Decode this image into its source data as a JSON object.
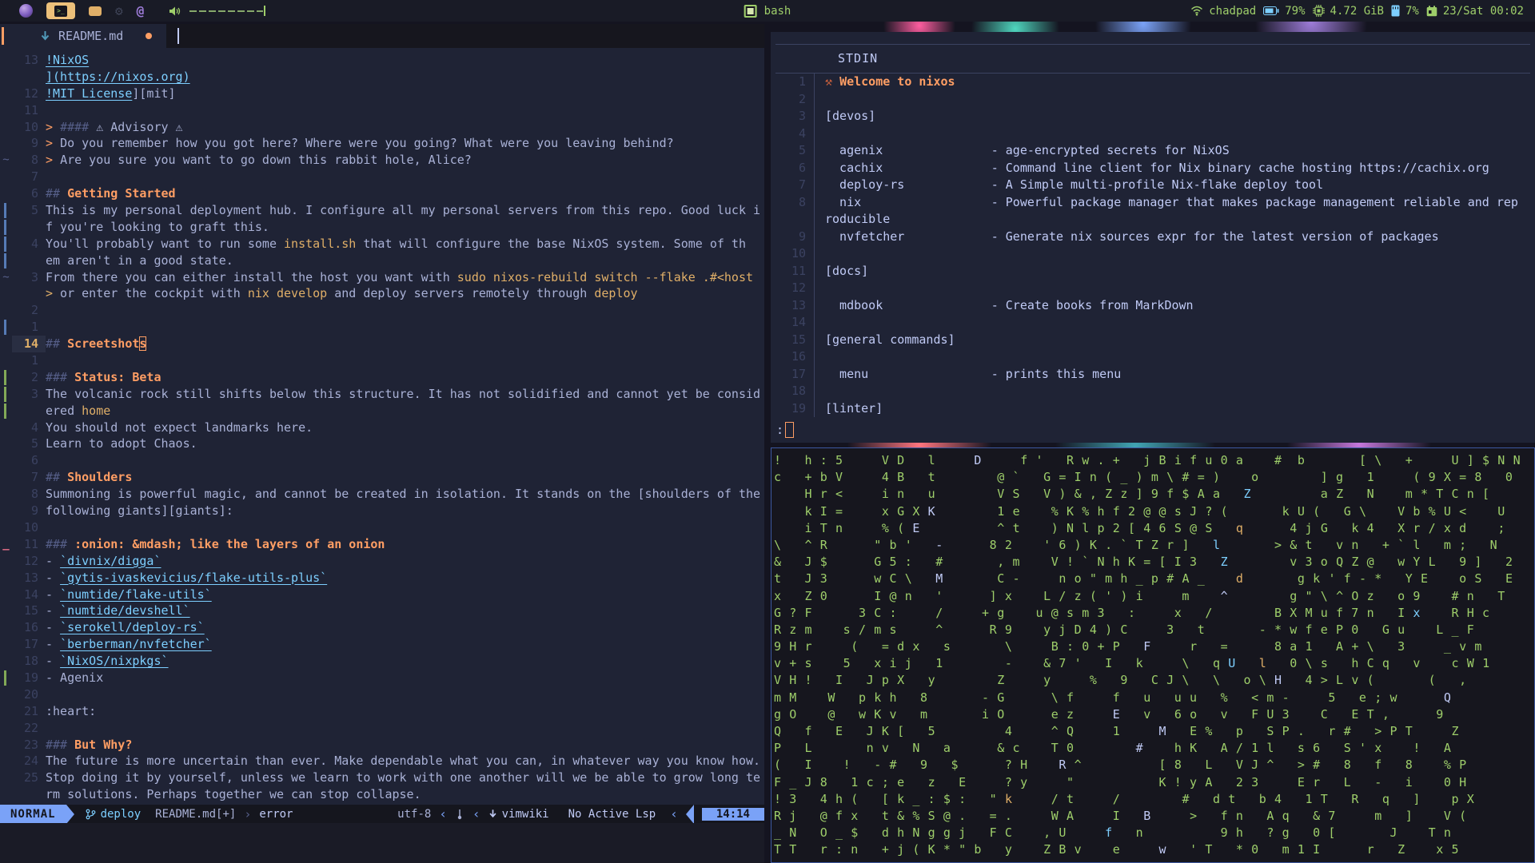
{
  "palette": {
    "bg": "#1f2335",
    "bar_bg": "#191b26",
    "accent_blue": "#7aa2f7",
    "accent_cyan": "#7dcfff",
    "accent_orange": "#ff9e64",
    "accent_yellow": "#e0af68",
    "accent_green": "#9ece6a",
    "accent_red": "#f7768e",
    "fg": "#a9b1d6",
    "dim": "#565f89",
    "linenr": "#3b4261"
  },
  "topbar": {
    "center_label": "bash",
    "network": "chadpad",
    "battery": "79%",
    "memory": "4.72 GiB",
    "cpu": "7%",
    "clock": "23/Sat 00:02"
  },
  "editor": {
    "tab": {
      "name": "README.md"
    },
    "statusline": {
      "mode": "NORMAL",
      "branch": "deploy",
      "file": "README.md[+]",
      "sep_r": "›",
      "diagnostic": "error",
      "encoding": "utf-8",
      "sep_l1": "‹",
      "sep_l2": "‹",
      "filetype": "vimwiki",
      "lsp": "No Active Lsp",
      "sep_l3": "‹",
      "position": "14:14"
    },
    "lines": [
      {
        "n": "13",
        "s": "",
        "segs": [
          {
            "c": "link",
            "t": "!NixOS"
          }
        ]
      },
      {
        "n": "",
        "s": "",
        "segs": [
          {
            "c": "link",
            "t": "](https://nixos.org)"
          }
        ]
      },
      {
        "n": "12",
        "s": "",
        "segs": [
          {
            "c": "link",
            "t": "!MIT License"
          },
          {
            "c": "txt",
            "t": "][mit]"
          }
        ]
      },
      {
        "n": "11",
        "s": "",
        "segs": []
      },
      {
        "n": "10",
        "s": "",
        "segs": [
          {
            "c": "quote",
            "t": "> "
          },
          {
            "c": "punct",
            "t": "#### "
          },
          {
            "c": "txt",
            "t": "⚠ Advisory ⚠"
          }
        ]
      },
      {
        "n": "9",
        "s": "",
        "segs": [
          {
            "c": "quote",
            "t": "> "
          },
          {
            "c": "txt",
            "t": "Do you remember how you got here? Where were you going? What were you leaving behind?"
          }
        ]
      },
      {
        "n": "8",
        "s": "tilde",
        "segs": [
          {
            "c": "quote",
            "t": "> "
          },
          {
            "c": "txt",
            "t": "Are you sure you want to go down this rabbit hole, Alice?"
          }
        ]
      },
      {
        "n": "7",
        "s": "",
        "segs": []
      },
      {
        "n": "6",
        "s": "",
        "segs": [
          {
            "c": "punct",
            "t": "## "
          },
          {
            "c": "h",
            "t": "Getting Started"
          }
        ]
      },
      {
        "n": "5",
        "s": "blue",
        "segs": [
          {
            "c": "txt",
            "t": "This is my personal deployment hub. I configure all my personal servers from this repo. Good luck i"
          }
        ]
      },
      {
        "n": "",
        "s": "blue",
        "segs": [
          {
            "c": "txt",
            "t": "f you're looking to graft this."
          }
        ]
      },
      {
        "n": "4",
        "s": "blue",
        "segs": [
          {
            "c": "txt",
            "t": "You'll probably want to run some "
          },
          {
            "c": "code",
            "t": "install.sh"
          },
          {
            "c": "txt",
            "t": " that will configure the base NixOS system. Some of th"
          }
        ]
      },
      {
        "n": "",
        "s": "blue",
        "segs": [
          {
            "c": "txt",
            "t": "em aren't in a good state."
          }
        ]
      },
      {
        "n": "3",
        "s": "tilde",
        "segs": [
          {
            "c": "txt",
            "t": "From there you can either install the host you want with "
          },
          {
            "c": "code",
            "t": "sudo nixos-rebuild switch --flake .#<host"
          }
        ]
      },
      {
        "n": "",
        "s": "",
        "segs": [
          {
            "c": "code",
            "t": ">"
          },
          {
            "c": "txt",
            "t": " or enter the cockpit with "
          },
          {
            "c": "code",
            "t": "nix develop"
          },
          {
            "c": "txt",
            "t": " and deploy servers remotely through "
          },
          {
            "c": "code",
            "t": "deploy"
          }
        ]
      },
      {
        "n": "2",
        "s": "",
        "segs": []
      },
      {
        "n": "1",
        "s": "blue",
        "segs": []
      },
      {
        "n": "14",
        "s": "",
        "cur": true,
        "segs": [
          {
            "c": "punct",
            "t": "## "
          },
          {
            "c": "h",
            "t": "Screetshot"
          },
          {
            "c": "hcur",
            "t": "s"
          }
        ]
      },
      {
        "n": "1",
        "s": "",
        "segs": []
      },
      {
        "n": "2",
        "s": "green",
        "segs": [
          {
            "c": "punct",
            "t": "### "
          },
          {
            "c": "h",
            "t": "Status: Beta"
          }
        ]
      },
      {
        "n": "3",
        "s": "green",
        "segs": [
          {
            "c": "txt",
            "t": "The volcanic rock still shifts below this structure. It has not solidified and cannot yet be consid"
          }
        ]
      },
      {
        "n": "",
        "s": "green",
        "segs": [
          {
            "c": "txt",
            "t": "ered "
          },
          {
            "c": "code",
            "t": "home"
          }
        ]
      },
      {
        "n": "4",
        "s": "",
        "segs": [
          {
            "c": "txt",
            "t": "You should not expect landmarks here."
          }
        ]
      },
      {
        "n": "5",
        "s": "",
        "segs": [
          {
            "c": "txt",
            "t": "Learn to adopt Chaos."
          }
        ]
      },
      {
        "n": "6",
        "s": "",
        "segs": []
      },
      {
        "n": "7",
        "s": "",
        "segs": [
          {
            "c": "punct",
            "t": "## "
          },
          {
            "c": "h",
            "t": "Shoulders"
          }
        ]
      },
      {
        "n": "8",
        "s": "",
        "segs": [
          {
            "c": "txt",
            "t": "Summoning is powerful magic, and cannot be created in isolation. It stands on the [shoulders of the"
          }
        ]
      },
      {
        "n": "9",
        "s": "",
        "segs": [
          {
            "c": "txt",
            "t": "following giants][giants]:"
          }
        ]
      },
      {
        "n": "10",
        "s": "",
        "segs": []
      },
      {
        "n": "11",
        "s": "del",
        "segs": [
          {
            "c": "punct",
            "t": "### "
          },
          {
            "c": "h",
            "t": ":onion: &mdash; like the layers of an onion"
          }
        ]
      },
      {
        "n": "12",
        "s": "",
        "segs": [
          {
            "c": "txt",
            "t": "- "
          },
          {
            "c": "link",
            "t": "`divnix/digga`"
          }
        ]
      },
      {
        "n": "13",
        "s": "",
        "segs": [
          {
            "c": "txt",
            "t": "- "
          },
          {
            "c": "link",
            "t": "`gytis-ivaskevicius/flake-utils-plus`"
          }
        ]
      },
      {
        "n": "14",
        "s": "",
        "segs": [
          {
            "c": "txt",
            "t": "- "
          },
          {
            "c": "link",
            "t": "`numtide/flake-utils`"
          }
        ]
      },
      {
        "n": "15",
        "s": "",
        "segs": [
          {
            "c": "txt",
            "t": "- "
          },
          {
            "c": "link",
            "t": "`numtide/devshell`"
          }
        ]
      },
      {
        "n": "16",
        "s": "",
        "segs": [
          {
            "c": "txt",
            "t": "- "
          },
          {
            "c": "link",
            "t": "`serokell/deploy-rs`"
          }
        ]
      },
      {
        "n": "17",
        "s": "",
        "segs": [
          {
            "c": "txt",
            "t": "- "
          },
          {
            "c": "link",
            "t": "`berberman/nvfetcher`"
          }
        ]
      },
      {
        "n": "18",
        "s": "",
        "segs": [
          {
            "c": "txt",
            "t": "- "
          },
          {
            "c": "link",
            "t": "`NixOS/nixpkgs`"
          }
        ]
      },
      {
        "n": "19",
        "s": "green",
        "segs": [
          {
            "c": "txt",
            "t": "- Agenix"
          }
        ]
      },
      {
        "n": "20",
        "s": "",
        "segs": []
      },
      {
        "n": "21",
        "s": "",
        "segs": [
          {
            "c": "txt",
            "t": ":heart:"
          }
        ]
      },
      {
        "n": "22",
        "s": "",
        "segs": []
      },
      {
        "n": "23",
        "s": "",
        "segs": [
          {
            "c": "punct",
            "t": "### "
          },
          {
            "c": "h",
            "t": "But Why?"
          }
        ]
      },
      {
        "n": "24",
        "s": "",
        "segs": [
          {
            "c": "txt",
            "t": "The future is more uncertain than ever. Make dependable what you can, in whatever way you know how."
          }
        ]
      },
      {
        "n": "25",
        "s": "",
        "segs": [
          {
            "c": "txt",
            "t": "Stop doing it by yourself, unless we learn to work with one another will we be able to grow long te"
          }
        ]
      },
      {
        "n": "",
        "s": "",
        "segs": [
          {
            "c": "txt",
            "t": "rm solutions. Perhaps together we can stop collapse."
          }
        ]
      }
    ]
  },
  "pager": {
    "header": "STDIN",
    "prompt": ":",
    "lines": [
      {
        "n": "1",
        "segs": [
          {
            "c": "hammer",
            "t": "⚒ "
          },
          {
            "c": "h",
            "t": "Welcome to nixos"
          }
        ]
      },
      {
        "n": "2",
        "segs": []
      },
      {
        "n": "3",
        "segs": [
          {
            "c": "white",
            "t": "[devos]"
          }
        ]
      },
      {
        "n": "4",
        "segs": []
      },
      {
        "n": "5",
        "segs": [
          {
            "c": "white",
            "t": "  agenix               - age-encrypted secrets for NixOS"
          }
        ]
      },
      {
        "n": "6",
        "segs": [
          {
            "c": "white",
            "t": "  cachix               - Command line client for Nix binary cache hosting https://cachix.org"
          }
        ]
      },
      {
        "n": "7",
        "segs": [
          {
            "c": "white",
            "t": "  deploy-rs            - A Simple multi-profile Nix-flake deploy tool"
          }
        ]
      },
      {
        "n": "8",
        "segs": [
          {
            "c": "white",
            "t": "  nix                  - Powerful package manager that makes package management reliable and rep"
          }
        ]
      },
      {
        "n": "",
        "segs": [
          {
            "c": "white",
            "t": "roducible"
          }
        ]
      },
      {
        "n": "9",
        "segs": [
          {
            "c": "white",
            "t": "  nvfetcher            - Generate nix sources expr for the latest version of packages"
          }
        ]
      },
      {
        "n": "10",
        "segs": []
      },
      {
        "n": "11",
        "segs": [
          {
            "c": "white",
            "t": "[docs]"
          }
        ]
      },
      {
        "n": "12",
        "segs": []
      },
      {
        "n": "13",
        "segs": [
          {
            "c": "white",
            "t": "  mdbook               - Create books from MarkDown"
          }
        ]
      },
      {
        "n": "14",
        "segs": []
      },
      {
        "n": "15",
        "segs": [
          {
            "c": "white",
            "t": "[general commands]"
          }
        ]
      },
      {
        "n": "16",
        "segs": []
      },
      {
        "n": "17",
        "segs": [
          {
            "c": "white",
            "t": "  menu                 - prints this menu"
          }
        ]
      },
      {
        "n": "18",
        "segs": []
      },
      {
        "n": "19",
        "segs": [
          {
            "c": "white",
            "t": "[linter]"
          }
        ]
      }
    ]
  },
  "noise": {
    "rows": [
      "!   h : 5     V D   l     D     f '   R w . +   j B i f u 0 a    #  b       [ \\   +     U ] $ N N",
      "c   + b V     4 B   t        @ `   G = I n ( _ ) m \\ # = )    o        ] g   1     ( 9 X = 8   0",
      "    H r <     i n   u        V S   V ) & , Z z ] 9 f $ A a   Z         a Z   N    m * T C n [",
      "    k I =     x G X K        1 e    % K % h f 2 @ @ s J ? (       k U (   G \\    V b % U <    U",
      "    i T n     % ( E          ^ t    ) N l p 2 [ 4 6 S @ S   q      4 j G   k 4   X r / x d    ;",
      "\\   ^ R      \" b '   -      8 2    ' 6 ) K . ` T Z r ]   l       > & t   v n   + ` l   m ;   N",
      "&   J $      G 5 :   #       , m    V ! ` N h K = [ I 3   Z        v 3 o Q Z @   w Y L   9 ]   2",
      "t   J 3      w C \\   M       C -     n o \" m h _ p # A _    d       g k ' f - *   Y E    o S   E",
      "x   Z 0      I @ n   '      ] x    L / z ( ' ) i     m    ^        g \" \\ ^ O z   o 9    # n   T",
      "G ? F      3 C :     /     + g    u @ s m 3   :     x   /        B X M u f 7 n   I x    R H c",
      "R z m    s / m s     ^      R 9    y j D 4 ) C     3   t       - * w f e P 0   G u    L _ F",
      "9 H r     (   = d x   s       \\     B : 0 + P   F     r   =      8 a 1   A + \\   3     _ v m",
      "v + s    5   x i j   1        -    & 7 '   I   k     \\   q U   l   0 \\ s   h C q   v    c W 1",
      "V H !   I   J p X   y        Z     y     %   9   C J \\   \\   o \\ H   4 > L v (       (   ,",
      "m M    W   p k h   8       - G      \\ f     f   u   u u   %   < m -     5   e ; w      Q",
      "g O    @   w K v   m       i O      e z     E   v   6 o   v   F U 3    C   E T ,      9",
      "Q   f   E   J K [   5         4     ^ Q     1     M   E %   p   S P .   r #   > P T     Z",
      "P   L       n v   N   a      & c    T 0        #    h K   A / 1 l   s 6   S ' x    !   A",
      "(   I    !   - #   9   $      ? H    R ^          [ 8   L   V J ^   > #   8   f   8    % P",
      "F _ J 8   1 c ; e   z   E     ? y     \"           K ! y A   2 3     E r   L   -   i    0 H",
      "! 3   4 h (   [ k _ : $ :   \" k     / t     /        #   d t   b 4   1 T   R   q   ]    p X",
      "R j   @ f x   t & % S @ .   = .     W A     I   B     >   f n   A q   & 7     m   ]    V (",
      "_ N   O _ $   d h N g g j   F C    , U     f   n          9 h   ? g   0 [       J    T n",
      "T T   r : n   + j ( K * \" b   y    Z B v    e     w   ' T   * 0   m 1 I      r   Z    x 5"
    ],
    "highlights": [
      [
        0,
        26,
        "w"
      ],
      [
        2,
        61,
        "c"
      ],
      [
        3,
        20,
        "w"
      ],
      [
        4,
        18,
        "w"
      ],
      [
        4,
        60,
        "y"
      ],
      [
        5,
        21,
        "w"
      ],
      [
        5,
        57,
        "c"
      ],
      [
        6,
        58,
        "c"
      ],
      [
        7,
        21,
        "w"
      ],
      [
        7,
        60,
        "y"
      ],
      [
        8,
        58,
        "w"
      ],
      [
        9,
        83,
        "c"
      ],
      [
        11,
        48,
        "w"
      ],
      [
        12,
        59,
        "c"
      ],
      [
        12,
        63,
        "y"
      ],
      [
        13,
        65,
        "w"
      ],
      [
        14,
        87,
        "w"
      ],
      [
        15,
        44,
        "w"
      ],
      [
        16,
        50,
        "w"
      ],
      [
        17,
        47,
        "w"
      ],
      [
        18,
        37,
        "w"
      ],
      [
        20,
        30,
        "y"
      ],
      [
        21,
        48,
        "w"
      ],
      [
        22,
        43,
        "c"
      ],
      [
        23,
        50,
        "w"
      ]
    ]
  }
}
